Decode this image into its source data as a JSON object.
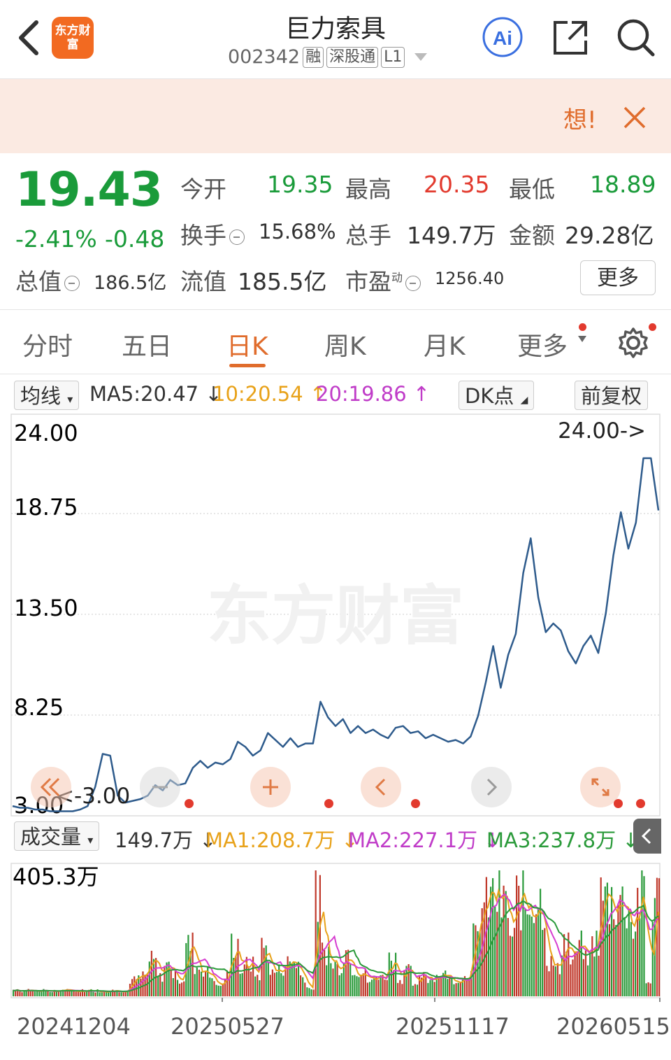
{
  "header": {
    "logo_text": "东方财富",
    "stock_name": "巨力索具",
    "stock_code": "002342",
    "tags": [
      "融",
      "深股通",
      "L1"
    ]
  },
  "banner": {
    "text": "想!"
  },
  "quote": {
    "price": "19.43",
    "change_pct": "-2.41%",
    "change_abs": "-0.48",
    "open_label": "今开",
    "open": "19.35",
    "high_label": "最高",
    "high": "20.35",
    "low_label": "最低",
    "low": "18.89",
    "turnover_label": "换手",
    "turnover": "15.68%",
    "volume_label": "总手",
    "volume": "149.7万",
    "amount_label": "金额",
    "amount": "29.28亿",
    "mktcap_label": "总值",
    "mktcap": "186.5亿",
    "float_label": "流值",
    "float": "185.5亿",
    "pe_label": "市盈",
    "pe_sup": "动",
    "pe": "1256.40",
    "more": "更多"
  },
  "tabs": [
    {
      "label": "分时"
    },
    {
      "label": "五日"
    },
    {
      "label": "日K",
      "active": true
    },
    {
      "label": "周K"
    },
    {
      "label": "月K"
    },
    {
      "label": "更多"
    }
  ],
  "ma_bar": {
    "type_label": "均线",
    "ma5": "MA5:20.47",
    "ma10": "10:20.54",
    "ma20": "20:19.86",
    "dk_label": "DK点",
    "adjust_label": "前复权"
  },
  "price_chart": {
    "y_labels": [
      "24.00",
      "18.75",
      "13.50",
      "8.25",
      "3.00"
    ],
    "max_marker": "24.00->",
    "min_marker": "<-3.00",
    "watermark": "东方财富",
    "line_color": "#2e5b8c"
  },
  "volume_bar": {
    "type_label": "成交量",
    "vol": "149.7万",
    "ma1": "MA1:208.7万",
    "ma2": "MA2:227.1万",
    "ma3": "MA3:237.8万",
    "y_label": "405.3万"
  },
  "x_dates": [
    "20241204",
    "20250527",
    "20251117",
    "20260515"
  ],
  "chart_data": {
    "type": "line",
    "ylim": [
      3.0,
      24.0
    ],
    "x_labels": [
      "20241204",
      "20250527",
      "20251117",
      "20260515"
    ],
    "values": [
      3.4,
      3.3,
      3.3,
      3.2,
      3.2,
      3.1,
      3.1,
      3.1,
      3.1,
      3.2,
      3.4,
      4.5,
      6.4,
      6.3,
      4.0,
      3.6,
      3.7,
      3.8,
      4.0,
      4.6,
      4.3,
      4.9,
      4.6,
      4.7,
      5.6,
      6.0,
      5.6,
      5.9,
      5.8,
      6.1,
      7.1,
      6.8,
      6.3,
      6.6,
      7.6,
      7.2,
      6.8,
      7.3,
      6.8,
      7.0,
      7.0,
      9.4,
      8.5,
      8.0,
      8.4,
      7.6,
      8.0,
      7.6,
      7.8,
      7.5,
      7.3,
      7.9,
      8.0,
      7.6,
      7.7,
      7.3,
      7.5,
      7.3,
      7.1,
      7.2,
      7.0,
      7.4,
      8.6,
      10.5,
      12.6,
      10.2,
      12.1,
      13.3,
      16.8,
      18.8,
      15.4,
      13.4,
      13.9,
      13.5,
      12.3,
      11.6,
      12.6,
      13.2,
      12.2,
      14.5,
      17.8,
      20.3,
      18.2,
      19.7,
      23.4,
      23.4,
      20.4
    ],
    "volume_ma1": "208.7万",
    "volume_ma2": "227.1万",
    "volume_ma3": "237.8万"
  }
}
